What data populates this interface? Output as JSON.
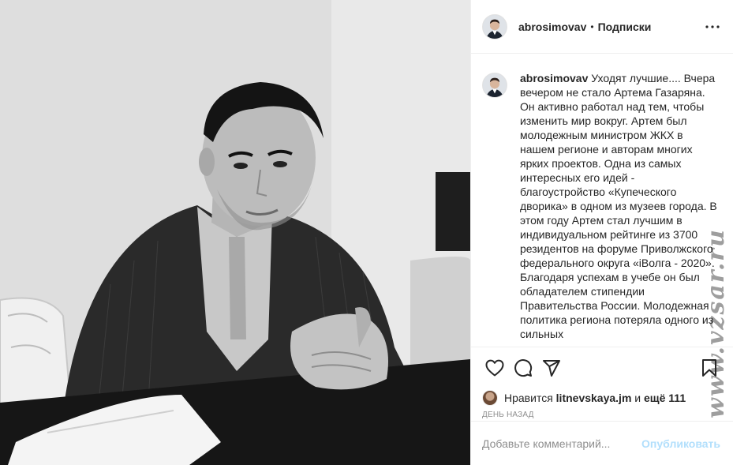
{
  "header": {
    "username": "abrosimovav",
    "separator": "•",
    "follow_label": "Подписки",
    "more_icon": "more-horizontal-icon"
  },
  "caption": {
    "username": "abrosimovav",
    "text": "Уходят лучшие.... Вчера вечером не стало Артема Газаряна. Он активно работал над тем, чтобы изменить мир вокруг. Артем был молодежным министром ЖКХ в нашем регионе и авторам многих ярких проектов. Одна из самых интересных его идей - благоустройство «Купеческого дворика» в одном из музеев города. В этом году Артем стал лучшим в индивидуальном рейтинге из 3700 резидентов на форуме Приволжского федерального округа «iВолга - 2020». Благодаря успехам в учебе он был обладателем стипендии Правительства России. Молодежная политика региона потеряла одного из сильных"
  },
  "actions": {
    "like_icon": "heart-icon",
    "comment_icon": "comment-icon",
    "share_icon": "share-icon",
    "save_icon": "bookmark-icon"
  },
  "likes": {
    "prefix": "Нравится",
    "user": "litnevskaya.jm",
    "and": "и",
    "others": "ещё 111"
  },
  "time": "ДЕНЬ НАЗАД",
  "comment_box": {
    "placeholder": "Добавьте комментарий...",
    "publish_label": "Опубликовать"
  },
  "watermark": "www.vzsar.ru",
  "colors": {
    "text": "#262626",
    "secondary": "#8e8e8e",
    "border": "#efefef",
    "publish_disabled": "#b2dffc"
  }
}
